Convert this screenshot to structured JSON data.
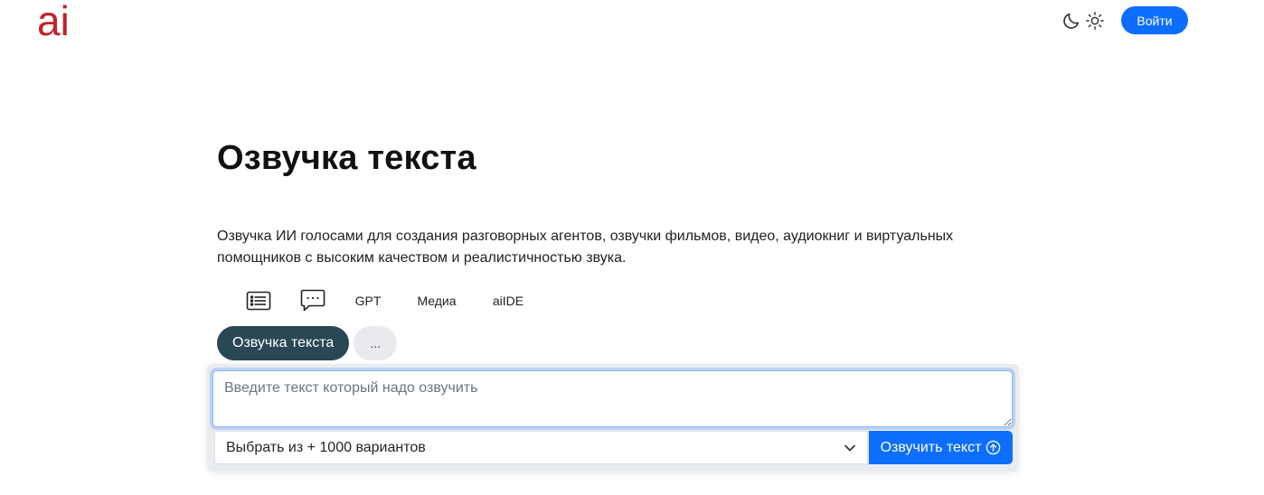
{
  "header": {
    "logo_text": "ai",
    "login_label": "Войти",
    "icons": [
      "moon-icon",
      "sun-icon"
    ],
    "accent_color": "#0d6efd",
    "logo_color": "#c0242a"
  },
  "main": {
    "title": "Озвучка текста",
    "description": "Озвучка ИИ голосами для создания разговорных агентов, озвучки фильмов, видео, аудиокниг и виртуальных помощников с высоким качеством и реалистичностью звука.",
    "category_tabs": [
      {
        "type": "icon",
        "icon": "list-icon"
      },
      {
        "type": "icon",
        "icon": "chat-bubble-icon"
      },
      {
        "type": "text",
        "label": "GPT"
      },
      {
        "type": "text",
        "label": "Медиа"
      },
      {
        "type": "text",
        "label": "aiIDE"
      }
    ],
    "pills": {
      "active_label": "Озвучка текста",
      "more_label": "..."
    },
    "form": {
      "text_placeholder": "Введите текст который надо озвучить",
      "text_value": "",
      "voice_select_value": "Выбрать из + 1000 вариантов",
      "submit_label": "Озвучить текст",
      "submit_icon": "arrow-up-circle-icon"
    },
    "pill_active_color": "#2a4756"
  }
}
